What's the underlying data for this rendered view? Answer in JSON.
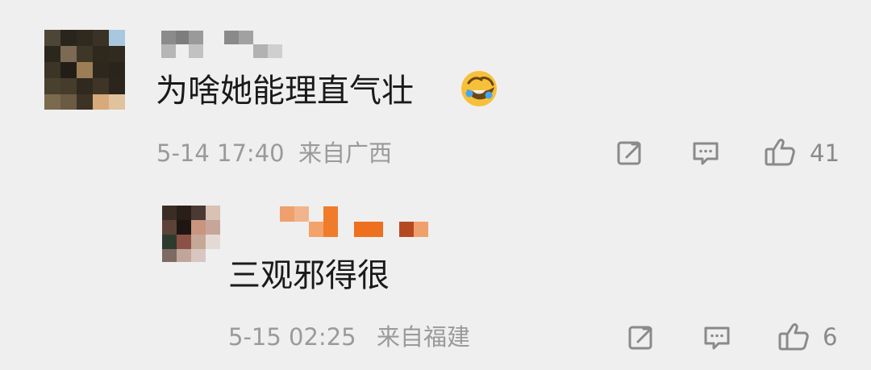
{
  "comments": [
    {
      "text": "为啥她能理直气壮",
      "emoji": "laughing-crying-emoji",
      "time": "5-14 17:40",
      "location": "来自广西",
      "actions": {
        "share_icon": "share-icon",
        "reply_icon": "comment-icon",
        "like_icon": "thumbs-up-icon",
        "like_count": "41"
      }
    },
    {
      "text": "三观邪得很",
      "time": "5-15 02:25",
      "location": "来自福建",
      "actions": {
        "share_icon": "share-icon",
        "reply_icon": "comment-icon",
        "like_icon": "thumbs-up-icon",
        "like_count": "6"
      }
    }
  ],
  "colors": {
    "background": "#efefef",
    "text": "#1a1a1a",
    "meta": "#9a9a9a",
    "icon": "#8a8a8a",
    "username_highlight": "#f07b2a"
  }
}
